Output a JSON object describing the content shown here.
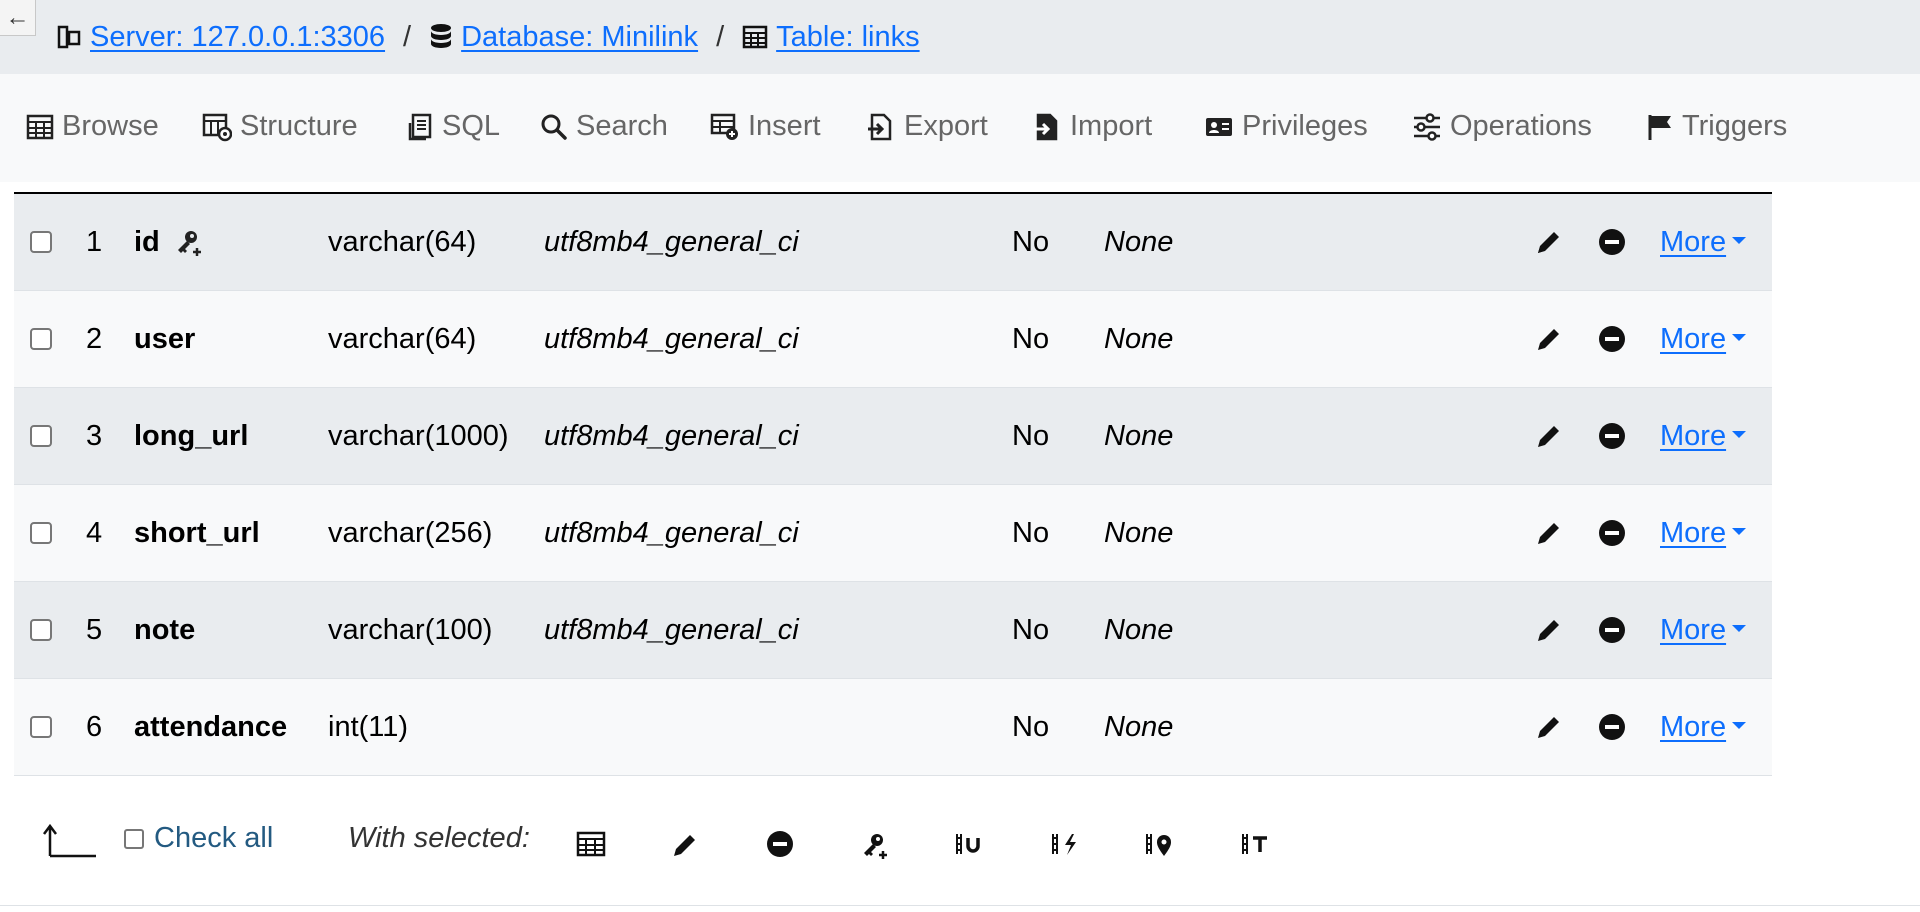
{
  "breadcrumb": {
    "back_label": "←",
    "server": "Server: 127.0.0.1:3306",
    "database": "Database: Minilink",
    "table": "Table: links",
    "separator": "/"
  },
  "tabs": [
    {
      "label": "Browse",
      "icon": "table-icon"
    },
    {
      "label": "Structure",
      "icon": "structure-icon"
    },
    {
      "label": "SQL",
      "icon": "sql-icon"
    },
    {
      "label": "Search",
      "icon": "search-icon"
    },
    {
      "label": "Insert",
      "icon": "insert-icon"
    },
    {
      "label": "Export",
      "icon": "export-icon"
    },
    {
      "label": "Import",
      "icon": "import-icon"
    },
    {
      "label": "Privileges",
      "icon": "privileges-icon"
    },
    {
      "label": "Operations",
      "icon": "operations-icon"
    },
    {
      "label": "Triggers",
      "icon": "flag-icon"
    }
  ],
  "columns": [
    {
      "num": "1",
      "name": "id",
      "type": "varchar(64)",
      "collation": "utf8mb4_general_ci",
      "null": "No",
      "default": "None",
      "primary_key": true
    },
    {
      "num": "2",
      "name": "user",
      "type": "varchar(64)",
      "collation": "utf8mb4_general_ci",
      "null": "No",
      "default": "None",
      "primary_key": false
    },
    {
      "num": "3",
      "name": "long_url",
      "type": "varchar(1000)",
      "collation": "utf8mb4_general_ci",
      "null": "No",
      "default": "None",
      "primary_key": false
    },
    {
      "num": "4",
      "name": "short_url",
      "type": "varchar(256)",
      "collation": "utf8mb4_general_ci",
      "null": "No",
      "default": "None",
      "primary_key": false
    },
    {
      "num": "5",
      "name": "note",
      "type": "varchar(100)",
      "collation": "utf8mb4_general_ci",
      "null": "No",
      "default": "None",
      "primary_key": false
    },
    {
      "num": "6",
      "name": "attendance",
      "type": "int(11)",
      "collation": "",
      "null": "No",
      "default": "None",
      "primary_key": false
    }
  ],
  "row_actions": {
    "more_label": "More"
  },
  "footer": {
    "check_all": "Check all",
    "with_selected": "With selected:",
    "icons": [
      "browse-icon",
      "change-icon",
      "drop-icon",
      "primary-key-icon",
      "unique-icon",
      "index-icon",
      "spatial-icon",
      "fulltext-icon"
    ]
  },
  "colors": {
    "link": "#0d6efd",
    "crumb_bg": "#e9ecef",
    "tab_bg": "#f8f9fa",
    "row_odd": "#e9ecef",
    "row_even": "#f8f9fa"
  }
}
